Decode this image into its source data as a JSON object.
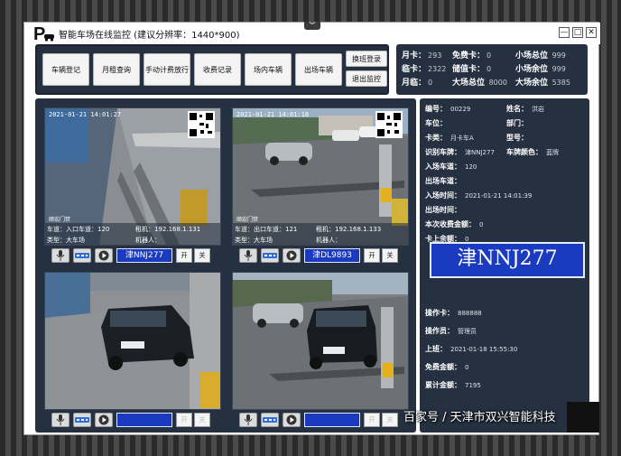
{
  "window": {
    "title": "智能车场在线监控 (建议分辨率：1440*900)",
    "controls": [
      "—",
      "□",
      "✕"
    ]
  },
  "nav": {
    "buttons": [
      "车辆登记",
      "月租查询",
      "手动计费放行",
      "收费记录",
      "场内车辆",
      "出场车辆"
    ],
    "shift_login": "换班登录",
    "exit_monitor": "退出监控"
  },
  "stats": [
    {
      "label": "月卡：",
      "value": "293"
    },
    {
      "label": "免费卡：",
      "value": "0"
    },
    {
      "label": "小场总位",
      "value": "999"
    },
    {
      "label": "临卡：",
      "value": "2322"
    },
    {
      "label": "储值卡：",
      "value": "0"
    },
    {
      "label": "小场余位",
      "value": "999"
    },
    {
      "label": "月临：",
      "value": "0"
    },
    {
      "label": "大场总位",
      "value": "8000"
    },
    {
      "label": "大场余位",
      "value": "5385"
    }
  ],
  "cameras": [
    {
      "timestamp": "2021-01-21 14:01:27",
      "brand": "顺宏门禁",
      "lane": "车道：入口车道：120",
      "host": "租机：192.168.1.131",
      "type": "类型：大车场",
      "robot": "机器人：",
      "plate": "津NNJ277",
      "open": "开",
      "close": "关"
    },
    {
      "timestamp": "2021-01-21 14:01:18",
      "brand": "顺宏门禁",
      "lane": "车道：出口车道：121",
      "host": "租机：192.168.1.133",
      "type": "类型：大车场",
      "robot": "机器人：",
      "plate": "津DL9893",
      "open": "开",
      "close": "关"
    },
    {
      "plate": "",
      "open": "开",
      "close": "关"
    },
    {
      "plate": "",
      "open": "开",
      "close": "关"
    }
  ],
  "detail": {
    "number_label": "编号：",
    "number": "00229",
    "name_label": "姓名：",
    "name": "洪岩",
    "space_label": "车位：",
    "dept_label": "部门：",
    "cardtype_label": "卡类：",
    "cardtype": "月卡车A",
    "model_label": "型号：",
    "plate_label": "识别车牌：",
    "plate": "津NNJ277",
    "color_label": "车牌颜色：",
    "color": "蓝牌",
    "in_lane_label": "入场车道：",
    "in_lane": "120",
    "out_lane_label": "出场车道：",
    "in_time_label": "入场时间：",
    "in_time": "2021-01-21 14:01:39",
    "out_time_label": "出场时间：",
    "fee_label": "本次收费金额：",
    "fee": "0",
    "balance_label": "卡上余额：",
    "balance": "0",
    "big_plate": "津NNJ277",
    "operator_card_label": "操作卡：",
    "operator_card": "888888",
    "operator_label": "操作员：",
    "operator": "管理员",
    "shift_label": "上班：",
    "shift": "2021-01-18 15:55:30",
    "free_label": "免费金额：",
    "free": "0",
    "total_label": "累计金额：",
    "total": "7195"
  },
  "watermark": "百家号 / 天津市双兴智能科技"
}
